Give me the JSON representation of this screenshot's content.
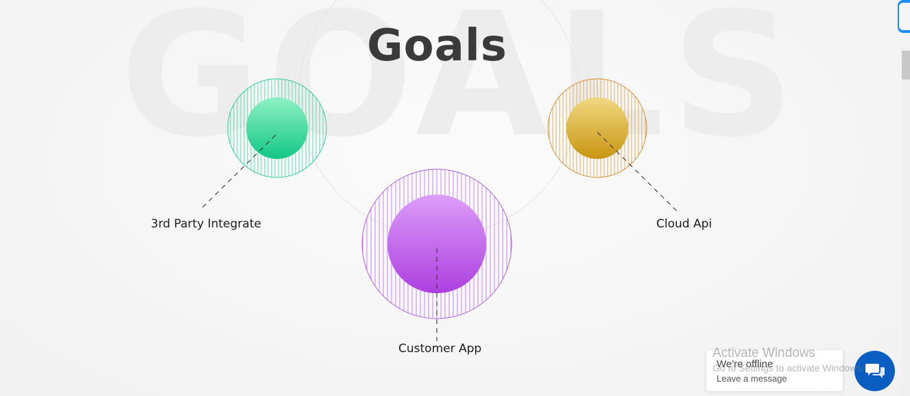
{
  "section": {
    "background_word": "GOALS",
    "title": "Goals"
  },
  "goals": [
    {
      "label": "3rd Party Integrate",
      "color": "#1fcb8e"
    },
    {
      "label": "Customer App",
      "color": "#b04fe0"
    },
    {
      "label": "Cloud Api",
      "color": "#d4a021"
    }
  ],
  "chat_widget": {
    "status": "We're offline",
    "action": "Leave a message",
    "icon": "chat-bubbles-icon",
    "color": "#0a5ec2"
  },
  "os_watermark": {
    "title": "Activate Windows",
    "subtitle": "Go to Settings to activate Windows."
  }
}
